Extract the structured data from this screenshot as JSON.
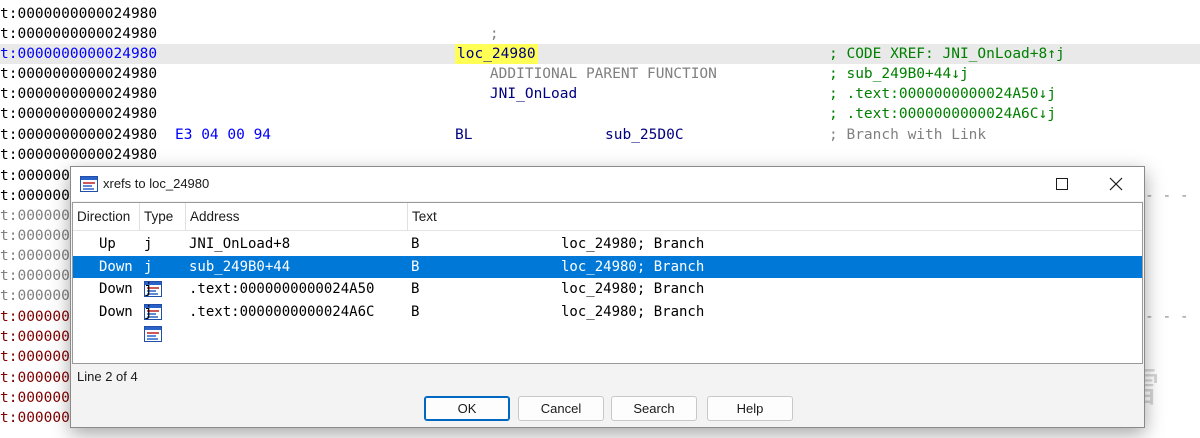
{
  "listing": {
    "header_semicolon": ";",
    "header_text": "ADDITIONAL PARENT FUNCTION",
    "header_func": "JNI_OnLoad",
    "lines": [
      {
        "addr": "t:0000000000024980",
        "style": "addr"
      },
      {
        "addr": "t:0000000000024980",
        "style": "addr"
      },
      {
        "addr": "t:0000000000024980",
        "style": "addr-blue",
        "label": "loc_24980",
        "comment": "; CODE XREF: JNI_OnLoad+8↑j"
      },
      {
        "addr": "t:0000000000024980",
        "style": "addr",
        "comment": "; sub_249B0+44↓j"
      },
      {
        "addr": "t:0000000000024980",
        "style": "addr",
        "comment": "; .text:0000000000024A50↓j"
      },
      {
        "addr": "t:0000000000024980",
        "style": "addr",
        "comment": "; .text:0000000000024A6C↓j"
      },
      {
        "addr": "t:0000000000024980",
        "style": "addr",
        "bytes": "E3 04 00 94",
        "mnemonic": "BL",
        "operand": "sub_25D0C",
        "comment_gray": "; Branch with Link"
      },
      {
        "addr": "t:0000000000024980",
        "style": "addr"
      },
      {
        "addr": "t:000000",
        "style": "addr"
      },
      {
        "addr": "t:000000",
        "style": "addr"
      },
      {
        "addr": "t:000000",
        "style": "addr-gray"
      },
      {
        "addr": "t:000000",
        "style": "addr-gray"
      },
      {
        "addr": "t:000000",
        "style": "addr-gray"
      },
      {
        "addr": "t:000000",
        "style": "addr-gray"
      },
      {
        "addr": "t:000000",
        "style": "addr-gray"
      },
      {
        "addr": "t:000000",
        "style": "addr-red"
      },
      {
        "addr": "t:000000",
        "style": "addr-red"
      },
      {
        "addr": "t:000000",
        "style": "addr-red"
      },
      {
        "addr": "t:000000",
        "style": "addr-red"
      },
      {
        "addr": "t:000000",
        "style": "addr-red"
      },
      {
        "addr": "t:000000",
        "style": "addr-red"
      }
    ]
  },
  "dialog": {
    "title": "xrefs to loc_24980",
    "columns": {
      "direction": "Direction",
      "type": "Type",
      "address": "Address",
      "text": "Text"
    },
    "rows": [
      {
        "direction": "Up",
        "type": "j",
        "address": "JNI_OnLoad+8",
        "op": "B",
        "args": "loc_24980; Branch",
        "selected": false
      },
      {
        "direction": "Down",
        "type": "j",
        "address": "sub_249B0+44",
        "op": "B",
        "args": "loc_24980; Branch",
        "selected": true
      },
      {
        "direction": "Down",
        "type": "j",
        "address": ".text:0000000000024A50",
        "op": "B",
        "args": "loc_24980; Branch",
        "selected": false
      },
      {
        "direction": "Down",
        "type": "j",
        "address": ".text:0000000000024A6C",
        "op": "B",
        "args": "loc_24980; Branch",
        "selected": false
      }
    ],
    "status": "Line 2 of 4",
    "buttons": {
      "ok": "OK",
      "cancel": "Cancel",
      "search": "Search",
      "help": "Help"
    }
  },
  "watermark": {
    "text": "看雪"
  },
  "colors": {
    "selection": "#0078d7",
    "label_highlight": "#ffff55",
    "comment_green": "#008000"
  }
}
